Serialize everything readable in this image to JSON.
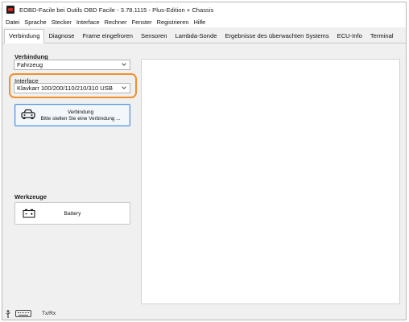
{
  "window": {
    "title": "EOBD-Facile bei Outils OBD Facile - 3.78.1115 - Plus-Edition + Chassis"
  },
  "menu": [
    "Datei",
    "Sprache",
    "Stecker",
    "Interface",
    "Rechner",
    "Fenster",
    "Registrieren",
    "Hilfe"
  ],
  "tabs": [
    {
      "label": "Verbindung",
      "active": true
    },
    {
      "label": "Diagnose",
      "active": false
    },
    {
      "label": "Frame eingefroren",
      "active": false
    },
    {
      "label": "Sensoren",
      "active": false
    },
    {
      "label": "Lambda-Sonde",
      "active": false
    },
    {
      "label": "Ergebnisse des überwachten Systems",
      "active": false
    },
    {
      "label": "ECU-Info",
      "active": false
    },
    {
      "label": "Terminal",
      "active": false
    }
  ],
  "connection": {
    "section_title": "Verbindung",
    "vehicle_select": "Fahrzeug",
    "interface_label": "Interface",
    "interface_select": "Klavkarr 100/200/110/210/310 USB",
    "connect_button": {
      "title": "Verbindung",
      "subtitle": "Bitte stellen Sie eine Verbindung ..."
    }
  },
  "tools": {
    "section_title": "Werkzeuge",
    "battery_button": "Battery"
  },
  "status": {
    "txrx": "Tx/Rx"
  },
  "colors": {
    "highlight": "#f0902a",
    "button_border": "#4a90d9",
    "panel_bg": "#ffffff",
    "window_bg": "#f0f0f0"
  },
  "icons": {
    "app": "app-icon",
    "connect": "car-icon",
    "battery": "battery-icon",
    "status_usb": "usb-icon",
    "status_keyboard": "keyboard-icon"
  }
}
